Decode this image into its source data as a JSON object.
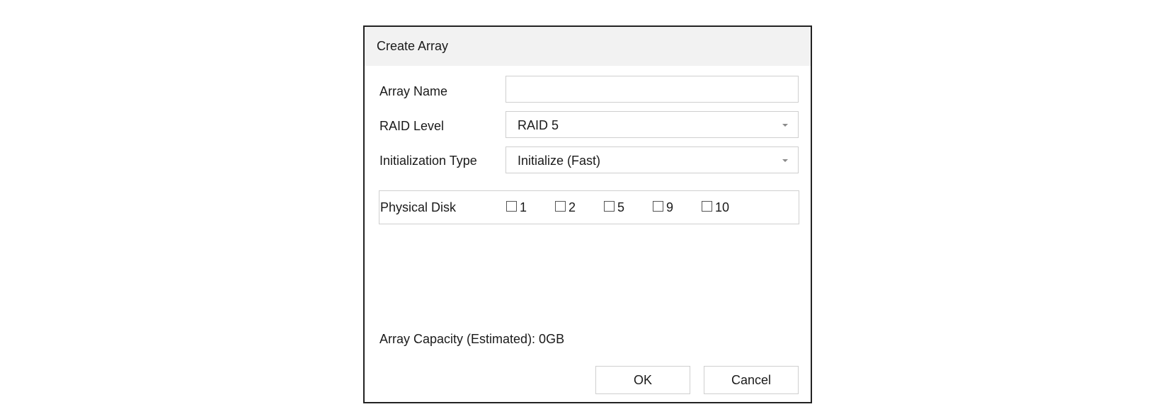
{
  "dialog": {
    "title": "Create Array"
  },
  "form": {
    "array_name": {
      "label": "Array Name",
      "value": "",
      "placeholder": ""
    },
    "raid_level": {
      "label": "RAID Level",
      "value": "RAID 5"
    },
    "init_type": {
      "label": "Initialization Type",
      "value": "Initialize (Fast)"
    },
    "physical_disk": {
      "label": "Physical Disk",
      "disks": [
        {
          "label": "1",
          "checked": false
        },
        {
          "label": "2",
          "checked": false
        },
        {
          "label": "5",
          "checked": false
        },
        {
          "label": "9",
          "checked": false
        },
        {
          "label": "10",
          "checked": false
        }
      ]
    }
  },
  "capacity": {
    "text": "Array Capacity (Estimated): 0GB"
  },
  "buttons": {
    "ok": "OK",
    "cancel": "Cancel"
  },
  "icons": {
    "dropdown": "caret-down-icon",
    "checkbox": "checkbox-unchecked-icon"
  }
}
